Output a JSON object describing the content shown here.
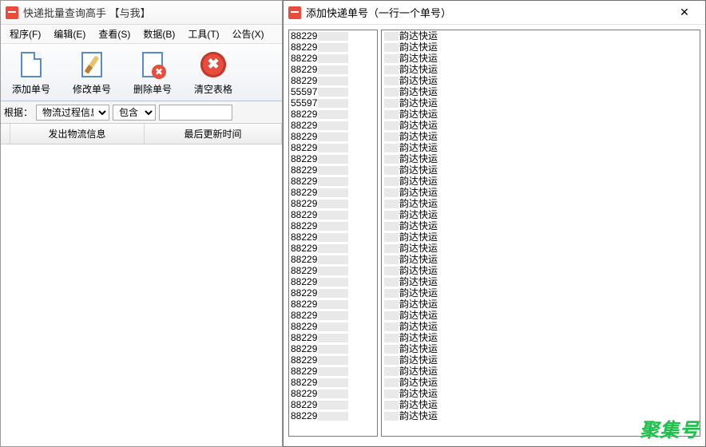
{
  "main_window": {
    "title": "快递批量查询高手 【与我】"
  },
  "menu": {
    "program": "程序(F)",
    "edit": "编辑(E)",
    "view": "查看(S)",
    "data": "数据(B)",
    "tools": "工具(T)",
    "notice": "公告(X)"
  },
  "toolbar": {
    "add": "添加单号",
    "edit": "修改单号",
    "delete": "删除单号",
    "clear": "清空表格"
  },
  "filter": {
    "label": "根据：",
    "field_selected": "物流过程信息",
    "op_selected": "包含",
    "value": ""
  },
  "grid": {
    "col_a": "发出物流信息",
    "col_b": "最后更新时间"
  },
  "dialog": {
    "title": "添加快递单号（一行一个单号）",
    "left_list": [
      "88229",
      "88229",
      "88229",
      "88229",
      "88229",
      "55597",
      "55597",
      "88229",
      "88229",
      "88229",
      "88229",
      "88229",
      "88229",
      "88229",
      "88229",
      "88229",
      "88229",
      "88229",
      "88229",
      "88229",
      "88229",
      "88229",
      "88229",
      "88229",
      "88229",
      "88229",
      "88229",
      "88229",
      "88229",
      "88229",
      "88229",
      "88229",
      "88229",
      "88229",
      "88229"
    ],
    "right_list_label": "韵达快运",
    "right_list_count": 35
  },
  "watermark": "聚集号"
}
